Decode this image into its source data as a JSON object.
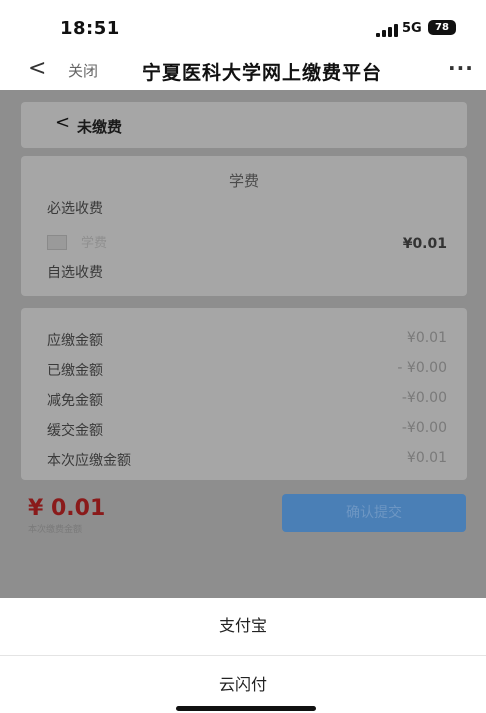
{
  "status_bar": {
    "time": "18:51",
    "network": "5G",
    "battery": "78"
  },
  "nav": {
    "back_icon": "chevron-left-icon",
    "close_label": "关闭",
    "title": "宁夏医科大学网上缴费平台",
    "more_icon": "more-icon",
    "more_glyph": "···"
  },
  "unpaid_header": {
    "back_glyph": "<",
    "label": "未缴费"
  },
  "fee_card": {
    "title": "学费",
    "required_label": "必选收费",
    "item_name": "学费",
    "item_amount": "¥0.01",
    "optional_label": "自选收费"
  },
  "summary": [
    {
      "label": "应缴金额",
      "value": "¥0.01"
    },
    {
      "label": "已缴金额",
      "value": "- ¥0.00"
    },
    {
      "label": "减免金额",
      "value": "-¥0.00"
    },
    {
      "label": "缓交金额",
      "value": "-¥0.00"
    },
    {
      "label": "本次应缴金额",
      "value": "¥0.01"
    }
  ],
  "footer": {
    "amount": "¥ 0.01",
    "amount_caption": "本次缴费金额",
    "confirm_label": "确认提交"
  },
  "payment_sheet": {
    "option1": "支付宝",
    "option2": "云闪付"
  },
  "colors": {
    "overlay_bg": "#8e8e8e",
    "amount_red": "#8a1a1a",
    "button_blue": "#4a7fb6"
  }
}
